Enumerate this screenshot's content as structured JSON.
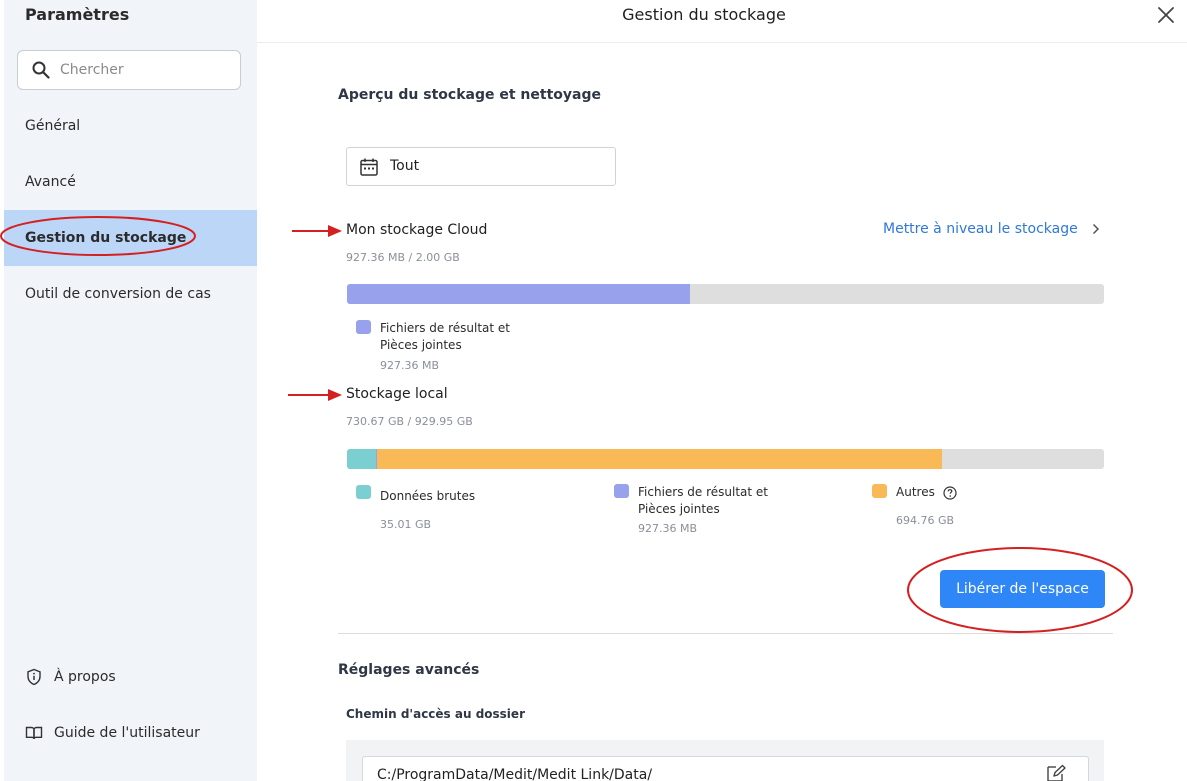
{
  "sidebar": {
    "title": "Paramètres",
    "search_placeholder": "Chercher",
    "items": [
      {
        "label": "Général"
      },
      {
        "label": "Avancé"
      },
      {
        "label": "Gestion du stockage"
      },
      {
        "label": "Outil de conversion de cas"
      }
    ],
    "bottom": {
      "about": "À propos",
      "guide": "Guide de l'utilisateur"
    }
  },
  "header": {
    "title": "Gestion du stockage"
  },
  "overview": {
    "title": "Aperçu du stockage et nettoyage",
    "date_filter": "Tout"
  },
  "cloud": {
    "label": "Mon stockage Cloud",
    "usage": "927.36 MB / 2.00 GB",
    "upgrade_link": "Mettre à niveau le stockage",
    "segments": [
      {
        "name": "Fichiers de résultat et Pièces jointes",
        "line1": "Fichiers de résultat et",
        "line2": "Pièces jointes",
        "value": "927.36 MB",
        "fraction": 0.453,
        "color": "#98a2ec"
      }
    ]
  },
  "local": {
    "label": "Stockage local",
    "usage": "730.67 GB / 929.95 GB",
    "segments": [
      {
        "line1": "Données brutes",
        "line2": "",
        "value": "35.01 GB",
        "fraction": 0.038,
        "color": "#7ccfd0"
      },
      {
        "line1": "Fichiers de résultat et",
        "line2": "Pièces jointes",
        "value": "927.36 MB",
        "fraction": 0.001,
        "color": "#98a2ec"
      },
      {
        "line1": "Autres",
        "line2": "",
        "value": "694.76 GB",
        "fraction": 0.747,
        "color": "#f8b956"
      }
    ]
  },
  "actions": {
    "free_space": "Libérer de l'espace"
  },
  "advanced": {
    "title": "Réglages avancés",
    "folder_label": "Chemin d'accès au dossier",
    "folder_path": "C:/ProgramData/Medit/Medit Link/Data/"
  },
  "colors": {
    "accent": "#2f86f6",
    "link": "#2f79d8",
    "active_nav": "#bcd6f7",
    "annotation": "#d42020"
  }
}
